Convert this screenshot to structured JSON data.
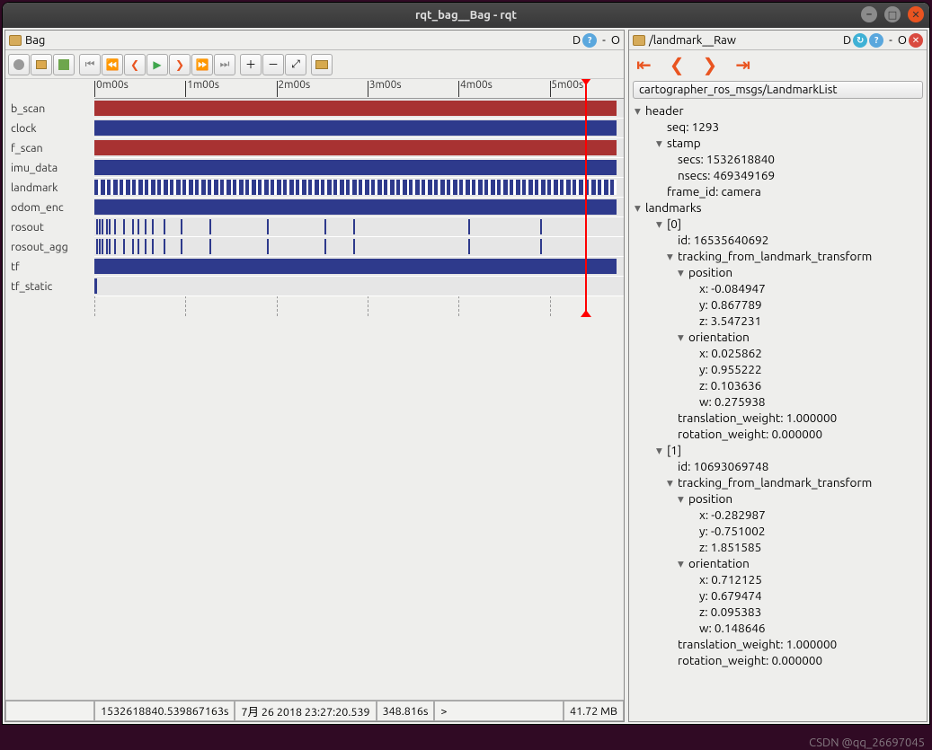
{
  "window": {
    "title": "rqt_bag__Bag - rqt"
  },
  "leftPane": {
    "title": "Bag",
    "hdrD": "D",
    "hdrDash": "-",
    "hdrO": "O",
    "ruler": [
      "0m00s",
      "1m00s",
      "2m00s",
      "3m00s",
      "4m00s",
      "5m00s"
    ],
    "topics": [
      "b_scan",
      "clock",
      "f_scan",
      "imu_data",
      "landmark",
      "odom_enc",
      "rosout",
      "rosout_agg",
      "tf",
      "tf_static"
    ],
    "status": {
      "blank": " ",
      "stamp": "1532618840.539867163s",
      "date": "7月 26 2018 23:27:20.539",
      "dur": "348.816s",
      "gt": ">",
      "size": "41.72 MB"
    }
  },
  "rightPane": {
    "title": "/landmark__Raw",
    "hdrD": "D",
    "hdrDash": "-",
    "hdrO": "O",
    "msgType": "cartographer_ros_msgs/LandmarkList",
    "tree": {
      "header": {
        "seq": "1293",
        "stamp": {
          "secs": "1532618840",
          "nsecs": "469349169"
        },
        "frame_id": "camera"
      },
      "landmarks": [
        {
          "id": "16535640692",
          "tracking_from_landmark_transform": {
            "position": {
              "x": "-0.084947",
              "y": "0.867789",
              "z": "3.547231"
            },
            "orientation": {
              "x": "0.025862",
              "y": "0.955222",
              "z": "0.103636",
              "w": "0.275938"
            }
          },
          "translation_weight": "1.000000",
          "rotation_weight": "0.000000"
        },
        {
          "id": "10693069748",
          "tracking_from_landmark_transform": {
            "position": {
              "x": "-0.282987",
              "y": "-0.751002",
              "z": "1.851585"
            },
            "orientation": {
              "x": "0.712125",
              "y": "0.679474",
              "z": "0.095383",
              "w": "0.148646"
            }
          },
          "translation_weight": "1.000000",
          "rotation_weight": "0.000000"
        }
      ]
    }
  },
  "watermark": "CSDN @qq_26697045"
}
